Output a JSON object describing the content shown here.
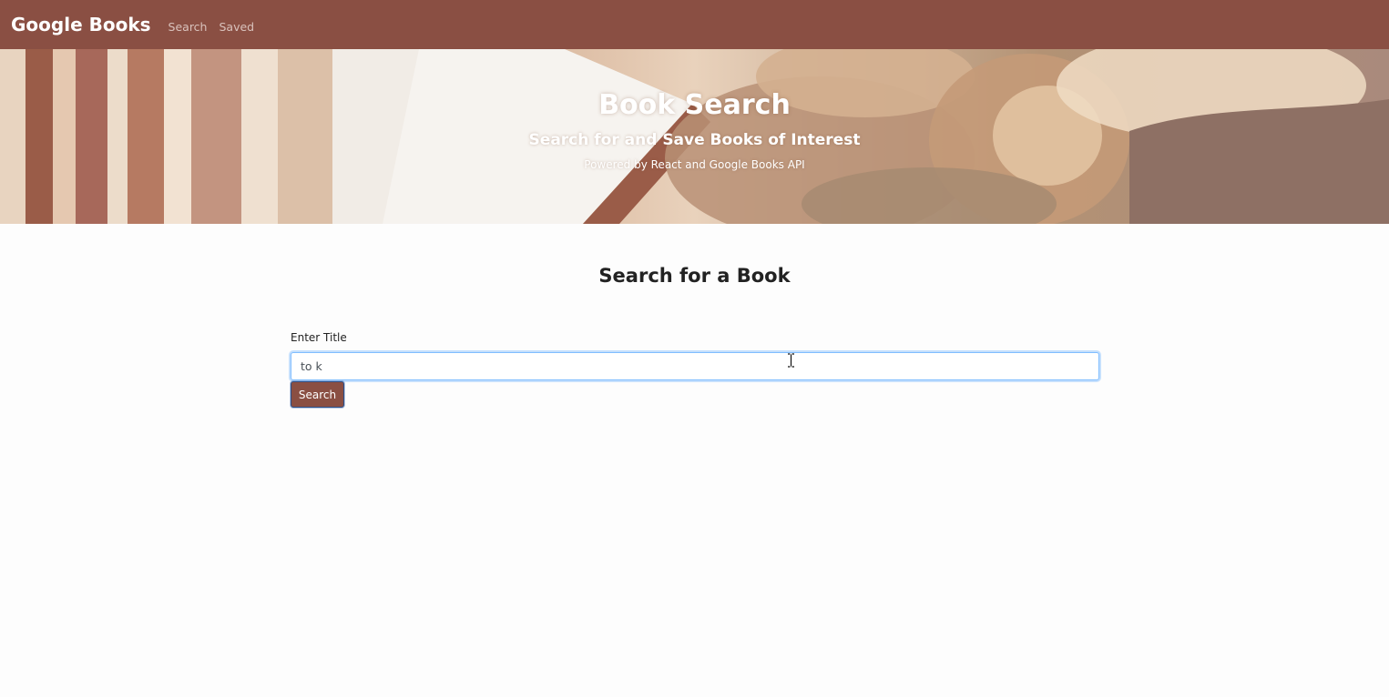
{
  "navbar": {
    "brand": "Google Books",
    "links": [
      {
        "label": "Search"
      },
      {
        "label": "Saved"
      }
    ],
    "background": "#8a4f43"
  },
  "hero": {
    "title": "Book Search",
    "subtitle": "Search for and Save Books of Interest",
    "caption": "Powered by React and Google Books API"
  },
  "main": {
    "heading": "Search for a Book",
    "form": {
      "label": "Enter Title",
      "input_value": "to k",
      "button_label": "Search"
    }
  },
  "colors": {
    "accent": "#8a4f43",
    "focus_ring": "#80bdff"
  },
  "icons": {
    "mouse_cursor": "text-cursor-icon"
  }
}
